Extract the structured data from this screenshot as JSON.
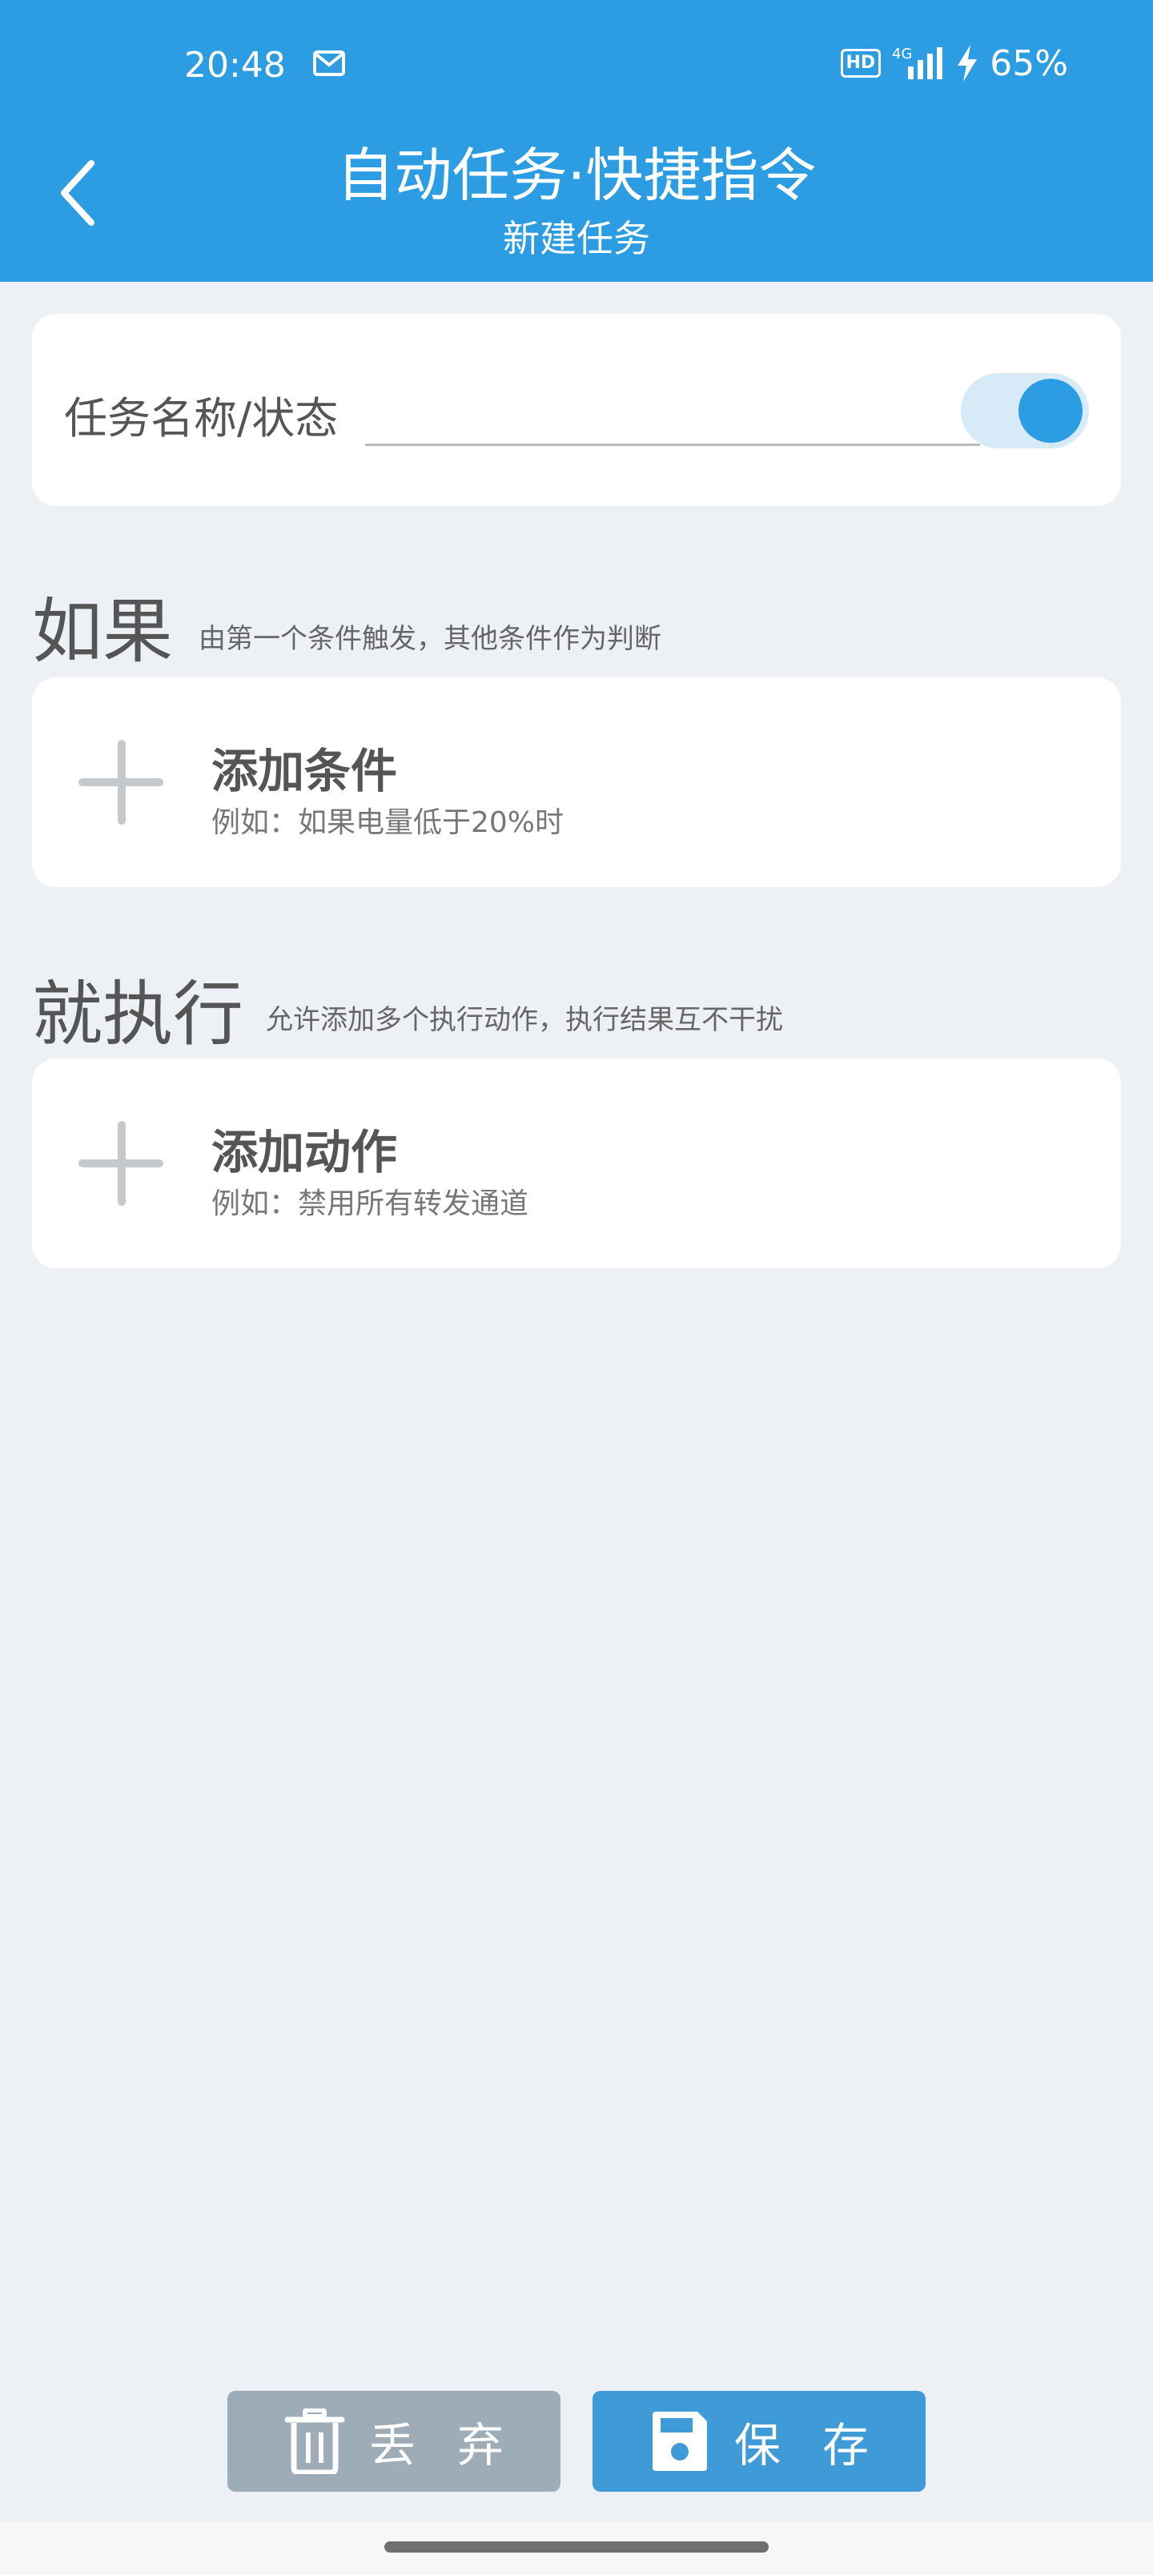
{
  "status_bar": {
    "time": "20:48",
    "hd": "HD",
    "network": "4G",
    "battery": "65%"
  },
  "header": {
    "title": "自动任务·快捷指令",
    "subtitle": "新建任务"
  },
  "task": {
    "name_label": "任务名称/状态",
    "name_value": "",
    "enabled": true
  },
  "if_section": {
    "title": "如果",
    "hint": "由第一个条件触发，其他条件作为判断",
    "add_title": "添加条件",
    "add_desc": "例如：如果电量低于20%时"
  },
  "then_section": {
    "title": "就执行",
    "hint": "允许添加多个执行动作，执行结果互不干扰",
    "add_title": "添加动作",
    "add_desc": "例如：禁用所有转发通道"
  },
  "buttons": {
    "discard": "丢弃",
    "save": "保存"
  },
  "colors": {
    "primary": "#2c9de3",
    "background": "#edf1f5",
    "discard": "#9eacb8",
    "save": "#3f9bd8"
  }
}
